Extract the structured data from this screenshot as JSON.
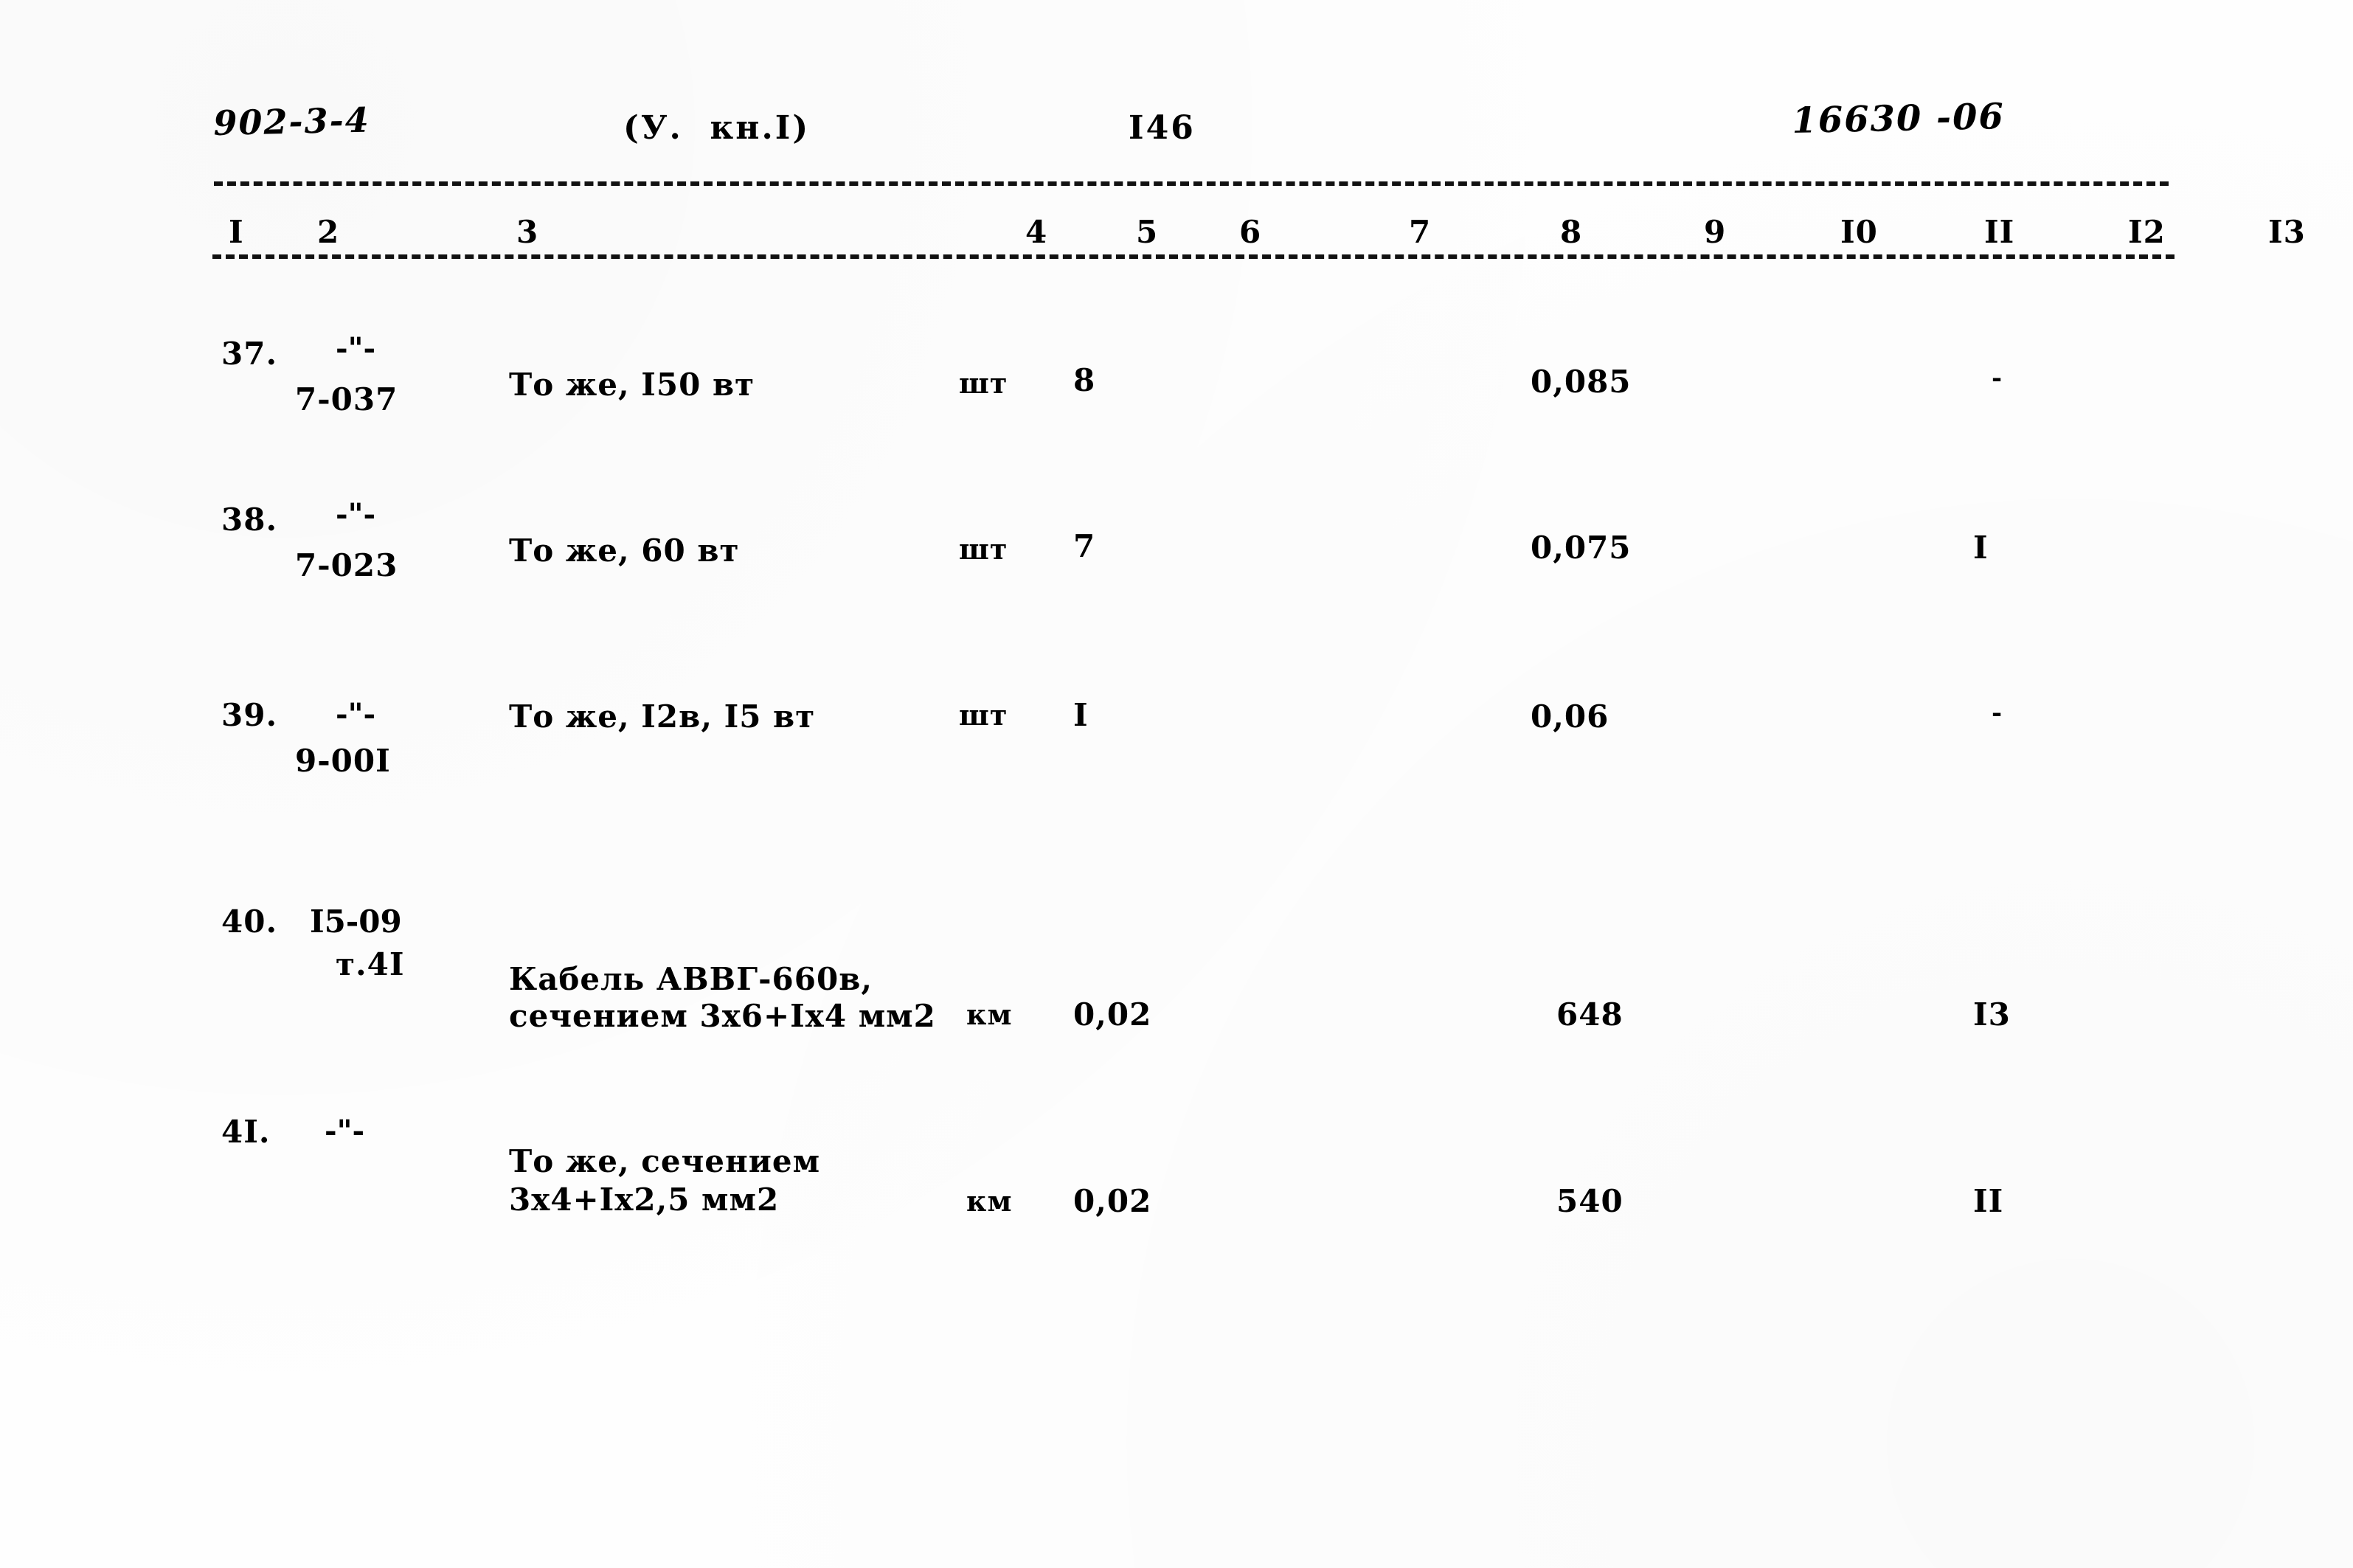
{
  "header": {
    "doc_code": "902-3-4",
    "volume_book": "(У.  кн.I)",
    "page_number": "I46",
    "archive_code": "16630 -06"
  },
  "column_numbers": [
    "I",
    "2",
    "3",
    "4",
    "5",
    "6",
    "7",
    "8",
    "9",
    "I0",
    "II",
    "I2",
    "I3"
  ],
  "rows": [
    {
      "num": "37.",
      "ditto": "-\"-",
      "code": "7-037",
      "name_line1": "То же, I50 вт",
      "name_line2": "",
      "unit": "шт",
      "qty": "8",
      "mass": "0,085",
      "note": "-"
    },
    {
      "num": "38.",
      "ditto": "-\"-",
      "code": "7-023",
      "name_line1": "То же, 60 вт",
      "name_line2": "",
      "unit": "шт",
      "qty": "7",
      "mass": "0,075",
      "note": "I"
    },
    {
      "num": "39.",
      "ditto": "-\"-",
      "code": "9-00I",
      "name_line1": "То же, I2в, I5 вт",
      "name_line2": "",
      "unit": "шт",
      "qty": "I",
      "mass": "0,06",
      "note": "-"
    },
    {
      "num": "40.",
      "ditto": "I5-09",
      "code": "т.4I",
      "name_line1": "Кабель АВВГ-660в,",
      "name_line2": "сечением 3х6+Iх4 мм2",
      "unit": "км",
      "qty": "0,02",
      "mass": "648",
      "note": "I3"
    },
    {
      "num": "4I.",
      "ditto": "-\"-",
      "code": "",
      "name_line1": "То же, сечением",
      "name_line2": "3х4+Iх2,5 мм2",
      "unit": "км",
      "qty": "0,02",
      "mass": "540",
      "note": "II"
    }
  ]
}
